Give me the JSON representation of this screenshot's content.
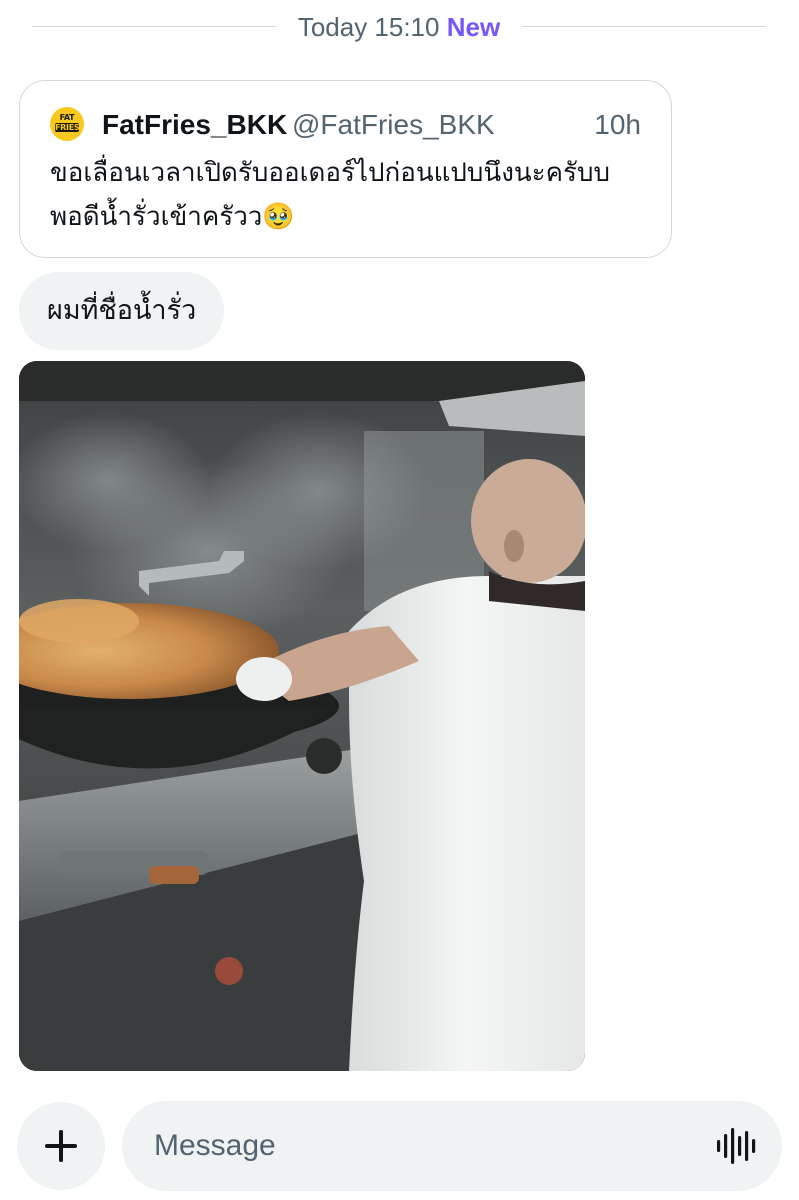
{
  "separator": {
    "date_label": "Today 15:10",
    "new_label": "New"
  },
  "quote": {
    "avatar_logo_line1": "FAT",
    "avatar_logo_line2": "FRIES",
    "display_name": "FatFries_BKK",
    "handle": "@FatFries_BKK",
    "time": "10h",
    "text": "ขอเลื่อนเวลาเปิดรับออเดอร์ไปก่อนแปบนึงนะครับบ พอดีน้ำรั่วเข้าครัวว",
    "emoji": "🥹"
  },
  "reply": {
    "text": "ผมที่ชื่อน้ำรั่ว"
  },
  "media": {
    "type": "gif"
  },
  "composer": {
    "placeholder": "Message",
    "add_icon": "plus-icon",
    "voice_icon": "voice-waveform-icon"
  },
  "colors": {
    "accent": "#7856ff",
    "text_primary": "#0f1419",
    "text_secondary": "#536471",
    "bubble_bg": "#eff3f4",
    "border": "#cfd9de",
    "avatar_brand": "#f8c81c"
  }
}
